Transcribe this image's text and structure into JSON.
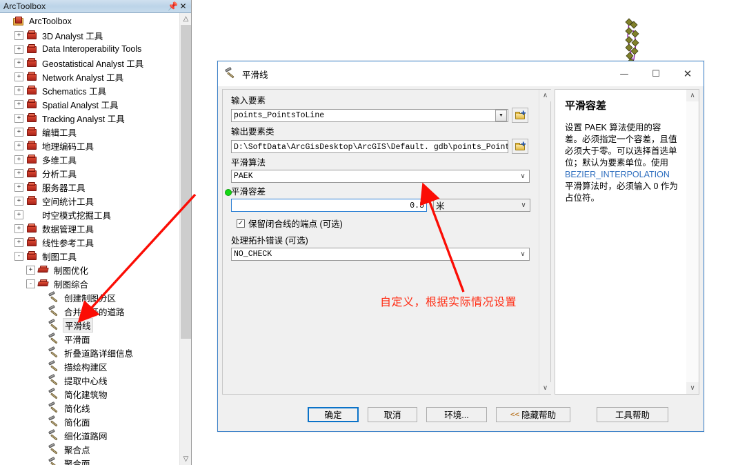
{
  "toolbox_panel": {
    "title": "ArcToolbox",
    "pin_icon": "pin-icon",
    "close_icon": "close-icon",
    "tree": [
      {
        "label": "ArcToolbox",
        "indent": 1,
        "expander": "none",
        "icon": "arctoolbox-root-icon",
        "selected": false
      },
      {
        "label": "3D Analyst 工具",
        "indent": 2,
        "expander": "+",
        "icon": "toolbox-icon",
        "selected": false
      },
      {
        "label": "Data Interoperability Tools",
        "indent": 2,
        "expander": "+",
        "icon": "toolbox-icon",
        "selected": false
      },
      {
        "label": "Geostatistical Analyst 工具",
        "indent": 2,
        "expander": "+",
        "icon": "toolbox-icon",
        "selected": false
      },
      {
        "label": "Network Analyst 工具",
        "indent": 2,
        "expander": "+",
        "icon": "toolbox-icon",
        "selected": false
      },
      {
        "label": "Schematics 工具",
        "indent": 2,
        "expander": "+",
        "icon": "toolbox-icon",
        "selected": false
      },
      {
        "label": "Spatial Analyst 工具",
        "indent": 2,
        "expander": "+",
        "icon": "toolbox-icon",
        "selected": false
      },
      {
        "label": "Tracking Analyst 工具",
        "indent": 2,
        "expander": "+",
        "icon": "toolbox-icon",
        "selected": false
      },
      {
        "label": "编辑工具",
        "indent": 2,
        "expander": "+",
        "icon": "toolbox-icon",
        "selected": false
      },
      {
        "label": "地理编码工具",
        "indent": 2,
        "expander": "+",
        "icon": "toolbox-icon",
        "selected": false
      },
      {
        "label": "多维工具",
        "indent": 2,
        "expander": "+",
        "icon": "toolbox-icon",
        "selected": false
      },
      {
        "label": "分析工具",
        "indent": 2,
        "expander": "+",
        "icon": "toolbox-icon",
        "selected": false
      },
      {
        "label": "服务器工具",
        "indent": 2,
        "expander": "+",
        "icon": "toolbox-icon",
        "selected": false
      },
      {
        "label": "空间统计工具",
        "indent": 2,
        "expander": "+",
        "icon": "toolbox-icon",
        "selected": false
      },
      {
        "label": "时空模式挖掘工具",
        "indent": 2,
        "expander": "+",
        "icon": "toolbox-blue-icon",
        "selected": false
      },
      {
        "label": "数据管理工具",
        "indent": 2,
        "expander": "+",
        "icon": "toolbox-icon",
        "selected": false
      },
      {
        "label": "线性参考工具",
        "indent": 2,
        "expander": "+",
        "icon": "toolbox-icon",
        "selected": false
      },
      {
        "label": "制图工具",
        "indent": 2,
        "expander": "-",
        "icon": "toolbox-icon",
        "selected": false
      },
      {
        "label": "制图优化",
        "indent": 3,
        "expander": "+",
        "icon": "toolset-icon",
        "selected": false
      },
      {
        "label": "制图综合",
        "indent": 3,
        "expander": "-",
        "icon": "toolset-icon",
        "selected": false
      },
      {
        "label": "创建制图分区",
        "indent": 4,
        "expander": "none",
        "icon": "tool-hammer-icon",
        "selected": false
      },
      {
        "label": "合并分开的道路",
        "indent": 4,
        "expander": "none",
        "icon": "tool-hammer-icon",
        "selected": false
      },
      {
        "label": "平滑线",
        "indent": 4,
        "expander": "none",
        "icon": "tool-hammer-icon",
        "selected": true
      },
      {
        "label": "平滑面",
        "indent": 4,
        "expander": "none",
        "icon": "tool-hammer-icon",
        "selected": false
      },
      {
        "label": "折叠道路详细信息",
        "indent": 4,
        "expander": "none",
        "icon": "tool-hammer-icon",
        "selected": false
      },
      {
        "label": "描绘构建区",
        "indent": 4,
        "expander": "none",
        "icon": "tool-hammer-icon",
        "selected": false
      },
      {
        "label": "提取中心线",
        "indent": 4,
        "expander": "none",
        "icon": "tool-hammer-icon",
        "selected": false
      },
      {
        "label": "简化建筑物",
        "indent": 4,
        "expander": "none",
        "icon": "tool-hammer-icon",
        "selected": false
      },
      {
        "label": "简化线",
        "indent": 4,
        "expander": "none",
        "icon": "tool-hammer-icon",
        "selected": false
      },
      {
        "label": "简化面",
        "indent": 4,
        "expander": "none",
        "icon": "tool-hammer-icon",
        "selected": false
      },
      {
        "label": "细化道路网",
        "indent": 4,
        "expander": "none",
        "icon": "tool-hammer-icon",
        "selected": false
      },
      {
        "label": "聚合点",
        "indent": 4,
        "expander": "none",
        "icon": "tool-hammer-icon",
        "selected": false
      },
      {
        "label": "聚合面",
        "indent": 4,
        "expander": "none",
        "icon": "tool-hammer-icon",
        "selected": false
      }
    ]
  },
  "dialog": {
    "title": "平滑线",
    "tool_icon": "tool-hammer-icon",
    "minimize_label": "—",
    "maximize_label": "☐",
    "close_label": "✕",
    "fields": {
      "input_features": {
        "label": "输入要素",
        "value": "points_PointsToLine",
        "browse_icon": "folder-browse-icon",
        "dropdown_icon": "dropdown-arrow-icon"
      },
      "output_feature_class": {
        "label": "输出要素类",
        "value": "D:\\SoftData\\ArcGisDesktop\\ArcGIS\\Default. gdb\\points_PointsToLine_Sm",
        "browse_icon": "folder-browse-icon"
      },
      "smoothing_algorithm": {
        "label": "平滑算法",
        "value": "PAEK",
        "dropdown_icon": "chevron-down-icon"
      },
      "smoothing_tolerance": {
        "label": "平滑容差",
        "value": "0.5",
        "required_marker": "required-green-dot",
        "unit": "米",
        "unit_dropdown_icon": "chevron-down-icon"
      },
      "preserve_endpoint": {
        "label": "保留闭合线的端点 (可选)",
        "checked": true,
        "check_glyph": "✓"
      },
      "handle_topological_errors": {
        "label": "处理拓扑错误 (可选)",
        "value": "NO_CHECK",
        "dropdown_icon": "chevron-down-icon"
      }
    },
    "help": {
      "title": "平滑容差",
      "body": "设置 PAEK 算法使用的容差。必须指定一个容差，且值必须大于零。可以选择首选单位；默认为要素单位。使用 ",
      "body_highlight": "BEZIER_INTERPOLATION",
      "body_tail": " 平滑算法时，必须输入 0 作为占位符。"
    },
    "buttons": {
      "ok": "确定",
      "cancel": "取消",
      "environments": "环境...",
      "hide_help": "隐藏帮助",
      "hide_help_chevron": "<<",
      "tool_help": "工具帮助"
    },
    "scrollbars": {
      "up_glyph": "∧",
      "down_glyph": "∨"
    }
  },
  "annotation": {
    "text": "自定义，根据实际情况设置",
    "color": "#ff2b12"
  },
  "colors": {
    "accent_blue": "#0a72c8",
    "panel_bg": "#f0f0f0",
    "annotation_red": "#ff2b12",
    "required_green": "#14d814",
    "map_line_purple": "#8b1fa8",
    "map_point_olive": "#80802a"
  }
}
